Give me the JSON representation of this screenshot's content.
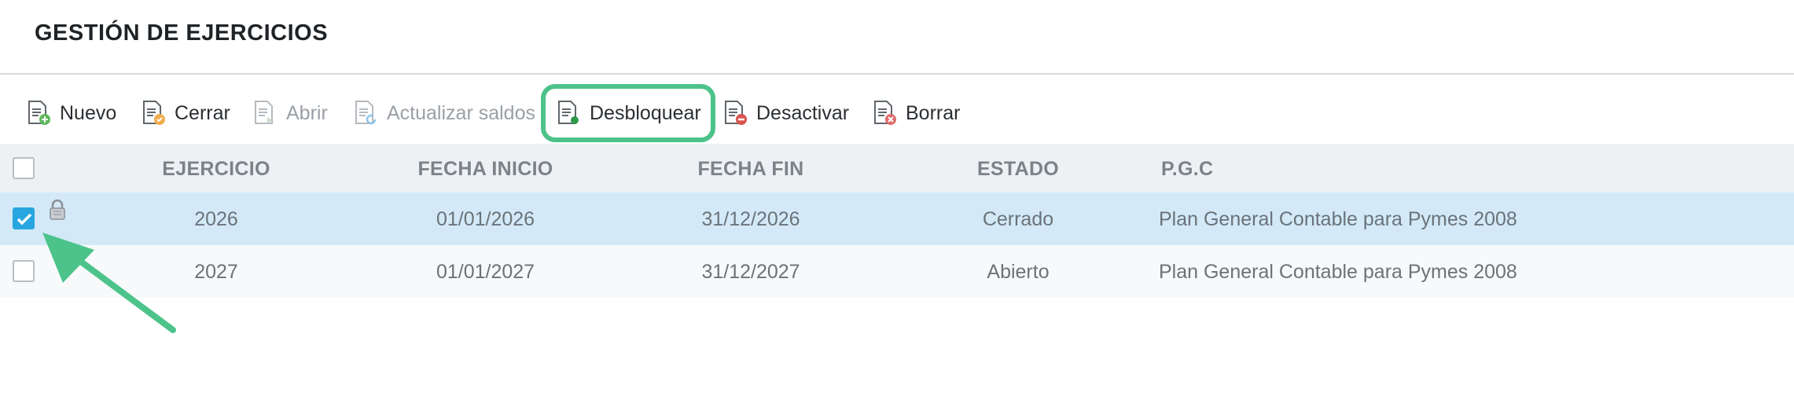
{
  "title": "GESTIÓN DE EJERCICIOS",
  "toolbar": {
    "nuevo": "Nuevo",
    "cerrar": "Cerrar",
    "abrir": "Abrir",
    "actualizar": "Actualizar saldos",
    "desbloquear": "Desbloquear",
    "desactivar": "Desactivar",
    "borrar": "Borrar"
  },
  "table": {
    "headers": {
      "ejercicio": "EJERCICIO",
      "fecha_inicio": "FECHA INICIO",
      "fecha_fin": "FECHA FIN",
      "estado": "ESTADO",
      "pgc": "P.G.C"
    },
    "rows": [
      {
        "ejercicio": "2026",
        "fecha_inicio": "01/01/2026",
        "fecha_fin": "31/12/2026",
        "estado": "Cerrado",
        "pgc": "Plan General Contable para Pymes 2008",
        "checked": true,
        "locked": true
      },
      {
        "ejercicio": "2027",
        "fecha_inicio": "01/01/2027",
        "fecha_fin": "31/12/2027",
        "estado": "Abierto",
        "pgc": "Plan General Contable para Pymes 2008",
        "checked": false,
        "locked": false
      }
    ]
  },
  "colors": {
    "highlight": "#4cc38a",
    "selected_row": "#d3e9f8",
    "checkbox_checked": "#27a6e0"
  }
}
